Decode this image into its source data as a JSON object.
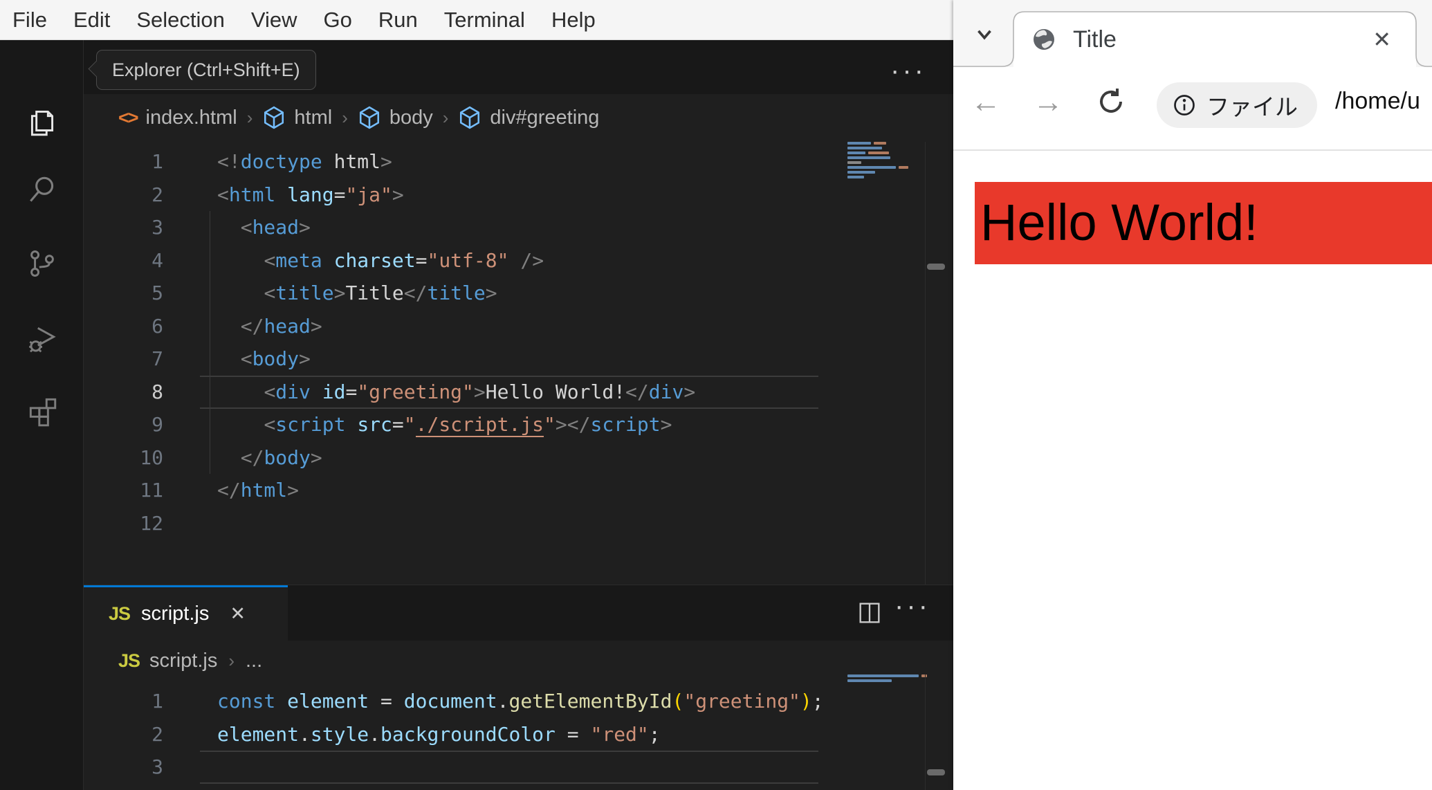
{
  "menu_bar": {
    "items": [
      "File",
      "Edit",
      "Selection",
      "View",
      "Go",
      "Run",
      "Terminal",
      "Help"
    ]
  },
  "activity_bar": {
    "items": [
      {
        "icon": "explorer-files-icon",
        "active": true
      },
      {
        "icon": "search-icon",
        "active": false
      },
      {
        "icon": "source-control-icon",
        "active": false
      },
      {
        "icon": "run-debug-icon",
        "active": false
      },
      {
        "icon": "extensions-icon",
        "active": false
      }
    ]
  },
  "tooltip": {
    "text": "Explorer (Ctrl+Shift+E)"
  },
  "editor": {
    "actions_more": "···",
    "breadcrumb": [
      {
        "icon": "html-file-icon",
        "label": "index.html"
      },
      {
        "icon": "symbol-cube-icon",
        "label": "html"
      },
      {
        "icon": "symbol-cube-icon",
        "label": "body"
      },
      {
        "icon": "symbol-cube-icon",
        "label": "div#greeting"
      }
    ],
    "active_line": 8,
    "lines": [
      [
        [
          "<!",
          "punct"
        ],
        [
          "doctype",
          "tag"
        ],
        [
          " html",
          "text"
        ],
        [
          ">",
          "punct"
        ]
      ],
      [
        [
          "<",
          "punct"
        ],
        [
          "html",
          "tag"
        ],
        [
          " ",
          "text"
        ],
        [
          "lang",
          "attr"
        ],
        [
          "=",
          "text"
        ],
        [
          "\"ja\"",
          "str"
        ],
        [
          ">",
          "punct"
        ]
      ],
      [
        [
          "  ",
          "text"
        ],
        [
          "<",
          "punct"
        ],
        [
          "head",
          "tag"
        ],
        [
          ">",
          "punct"
        ]
      ],
      [
        [
          "    ",
          "text"
        ],
        [
          "<",
          "punct"
        ],
        [
          "meta",
          "tag"
        ],
        [
          " ",
          "text"
        ],
        [
          "charset",
          "attr"
        ],
        [
          "=",
          "text"
        ],
        [
          "\"utf-8\"",
          "str"
        ],
        [
          " ",
          "text"
        ],
        [
          "/>",
          "punct"
        ]
      ],
      [
        [
          "    ",
          "text"
        ],
        [
          "<",
          "punct"
        ],
        [
          "title",
          "tag"
        ],
        [
          ">",
          "punct"
        ],
        [
          "Title",
          "text"
        ],
        [
          "</",
          "punct"
        ],
        [
          "title",
          "tag"
        ],
        [
          ">",
          "punct"
        ]
      ],
      [
        [
          "  ",
          "text"
        ],
        [
          "</",
          "punct"
        ],
        [
          "head",
          "tag"
        ],
        [
          ">",
          "punct"
        ]
      ],
      [
        [
          "  ",
          "text"
        ],
        [
          "<",
          "punct"
        ],
        [
          "body",
          "tag"
        ],
        [
          ">",
          "punct"
        ]
      ],
      [
        [
          "    ",
          "text"
        ],
        [
          "<",
          "punct"
        ],
        [
          "div",
          "tag"
        ],
        [
          " ",
          "text"
        ],
        [
          "id",
          "attr"
        ],
        [
          "=",
          "text"
        ],
        [
          "\"greeting\"",
          "str"
        ],
        [
          ">",
          "punct"
        ],
        [
          "Hello World!",
          "text"
        ],
        [
          "</",
          "punct"
        ],
        [
          "div",
          "tag"
        ],
        [
          ">",
          "punct"
        ]
      ],
      [
        [
          "    ",
          "text"
        ],
        [
          "<",
          "punct"
        ],
        [
          "script",
          "tag"
        ],
        [
          " ",
          "text"
        ],
        [
          "src",
          "attr"
        ],
        [
          "=",
          "text"
        ],
        [
          "\"",
          "str"
        ],
        [
          "./script.js",
          "link"
        ],
        [
          "\"",
          "str"
        ],
        [
          ">",
          "punct"
        ],
        [
          "</",
          "punct"
        ],
        [
          "script",
          "tag"
        ],
        [
          ">",
          "punct"
        ]
      ],
      [
        [
          "  ",
          "text"
        ],
        [
          "</",
          "punct"
        ],
        [
          "body",
          "tag"
        ],
        [
          ">",
          "punct"
        ]
      ],
      [
        [
          "</",
          "punct"
        ],
        [
          "html",
          "tag"
        ],
        [
          ">",
          "punct"
        ]
      ],
      []
    ]
  },
  "panel": {
    "tab": {
      "icon": "javascript-icon",
      "icon_text": "JS",
      "label": "script.js",
      "close": "✕"
    },
    "actions": {
      "split_icon": "split-editor-icon",
      "more": "···"
    },
    "breadcrumb": [
      {
        "icon": "javascript-icon",
        "label": "script.js"
      },
      {
        "icon": null,
        "label": "..."
      }
    ],
    "active_line": 3,
    "lines": [
      [
        [
          "const",
          "kw"
        ],
        [
          " ",
          "text"
        ],
        [
          "element",
          "var"
        ],
        [
          " = ",
          "text"
        ],
        [
          "document",
          "var"
        ],
        [
          ".",
          "text"
        ],
        [
          "getElementById",
          "fn"
        ],
        [
          "(",
          "paren"
        ],
        [
          "\"greeting\"",
          "str"
        ],
        [
          ")",
          "paren"
        ],
        [
          ";",
          "text"
        ]
      ],
      [
        [
          "element",
          "var"
        ],
        [
          ".",
          "text"
        ],
        [
          "style",
          "var"
        ],
        [
          ".",
          "text"
        ],
        [
          "backgroundColor",
          "var"
        ],
        [
          " = ",
          "text"
        ],
        [
          "\"red\"",
          "str"
        ],
        [
          ";",
          "text"
        ]
      ],
      []
    ]
  },
  "browser": {
    "tab": {
      "icon": "globe-icon",
      "title": "Title",
      "close": "✕"
    },
    "toolbar": {
      "back_icon": "←",
      "forward_icon": "→",
      "reload_icon": "reload-icon",
      "chip": {
        "icon": "info-icon",
        "label": "ファイル"
      },
      "url": "/home/u"
    },
    "page": {
      "greeting_text": "Hello World!",
      "greeting_bg": "#e8392b"
    }
  },
  "colors": {
    "accent_blue_tab_border": "#0078d4",
    "token_tag": "#569cd6",
    "token_attr": "#9cdcfe",
    "token_string": "#ce9178",
    "token_text": "#d4d4d4",
    "token_punct": "#808080",
    "token_fn": "#dcdcaa",
    "token_paren": "#ffd700",
    "js_badge": "#cbcb41",
    "breadcrumb_symbol": "#75beff",
    "html_file_icon": "#e37933",
    "editor_bg": "#1f1f1f",
    "chrome_bg": "#181818",
    "page_red": "#e8392b"
  }
}
